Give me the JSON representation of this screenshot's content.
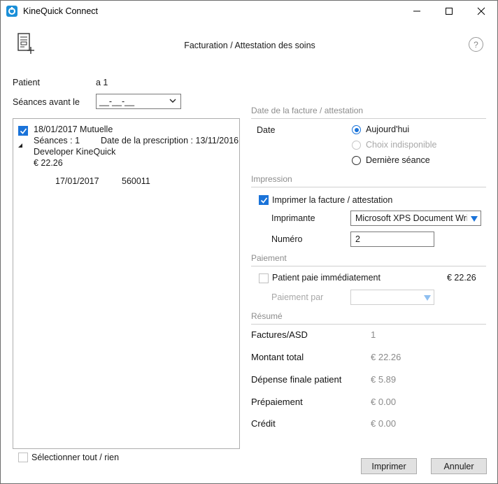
{
  "window": {
    "title": "KineQuick Connect"
  },
  "header": {
    "title": "Facturation / Attestation des soins",
    "help_glyph": "?"
  },
  "patient": {
    "label": "Patient",
    "value": "a 1"
  },
  "seances_avant": {
    "label": "Séances avant le",
    "value": "__-__-__"
  },
  "invoices": [
    {
      "checked": true,
      "date_type": "18/01/2017 Mutuelle",
      "seances": "Séances : 1",
      "prescription": "Date de la prescription : 13/11/2016",
      "therapist": "Developer KineQuick",
      "amount": "€ 22.26",
      "sessions": [
        {
          "date": "17/01/2017",
          "code": "560011"
        }
      ]
    }
  ],
  "select_all": {
    "label": "Sélectionner tout / rien",
    "checked": false
  },
  "date_section": {
    "title": "Date de la facture / attestation",
    "label": "Date",
    "options": [
      {
        "label": "Aujourd'hui",
        "selected": true,
        "disabled": false
      },
      {
        "label": "Choix indisponible",
        "selected": false,
        "disabled": true
      },
      {
        "label": "Dernière séance",
        "selected": false,
        "disabled": false
      }
    ]
  },
  "impression": {
    "title": "Impression",
    "print_label": "Imprimer la facture / attestation",
    "print_checked": true,
    "printer_label": "Imprimante",
    "printer_value": "Microsoft XPS Document Writ",
    "numero_label": "Numéro",
    "numero_value": "2"
  },
  "paiement": {
    "title": "Paiement",
    "immediate_label": "Patient paie immédiatement",
    "immediate_checked": false,
    "amount": "€ 22.26",
    "method_label": "Paiement par",
    "method_value": ""
  },
  "resume": {
    "title": "Résumé",
    "rows": [
      {
        "label": "Factures/ASD",
        "value": "1"
      },
      {
        "label": "Montant total",
        "value": "€ 22.26"
      },
      {
        "label": "Dépense finale patient",
        "value": "€ 5.89"
      },
      {
        "label": "Prépaiement",
        "value": "€ 0.00"
      },
      {
        "label": "Crédit",
        "value": "€ 0.00"
      }
    ]
  },
  "buttons": {
    "print": "Imprimer",
    "cancel": "Annuler"
  },
  "colors": {
    "accent": "#1a73d9",
    "section_header": "#8c8c8c",
    "value_gray": "#8a8a8a"
  }
}
